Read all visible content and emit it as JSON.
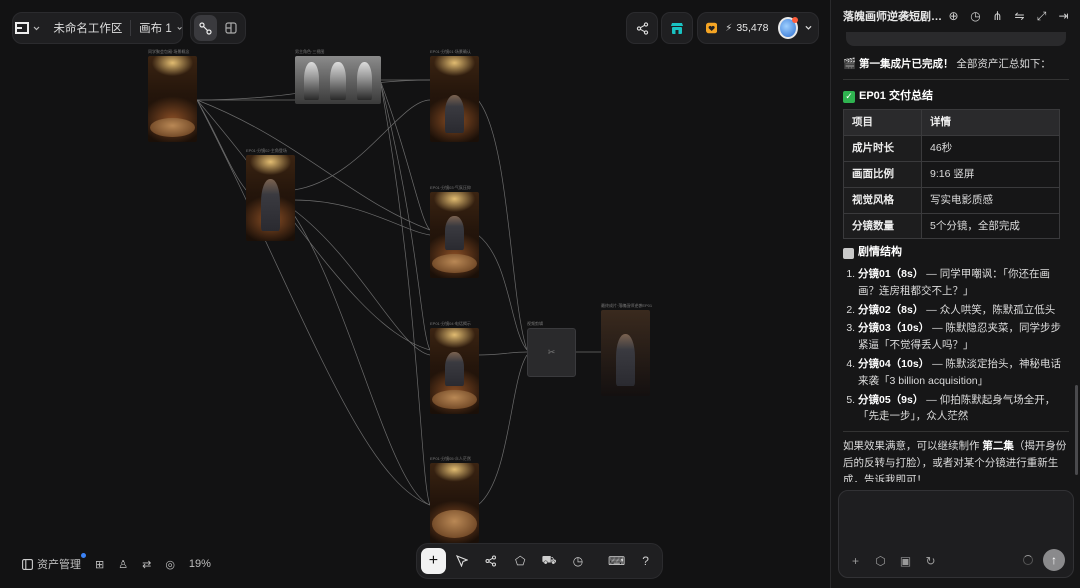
{
  "header": {
    "workspace_name": "未命名工作区",
    "canvas_name": "画布 1",
    "credits": "35,478"
  },
  "bottom_bar": {
    "assets_label": "资产管理",
    "zoom": "19%"
  },
  "canvas": {
    "node_labels": [
      "同学聚会包厢·场景概念",
      "男主角色·三视图",
      "EP01·分镜01·场景确认",
      "EP01·分镜02·主角登场",
      "EP01·分镜03·气氛压抑",
      "EP01·分镜04·电话揭示",
      "EP01·分镜05·众人茫然",
      "视频剪辑",
      "最终成片·落魄画师逆袭EP01"
    ]
  },
  "panel": {
    "title": "落魄画师逆袭短剧…",
    "intro_emoji": "🎬",
    "intro_bold": "第一集成片已完成！",
    "intro_rest": "全部资产汇总如下：",
    "delivery_heading": "EP01 交付总结",
    "table": {
      "headers": [
        "项目",
        "详情"
      ],
      "rows": [
        {
          "k": "成片时长",
          "v": "46秒"
        },
        {
          "k": "画面比例",
          "v": "9:16 竖屏"
        },
        {
          "k": "视觉风格",
          "v": "写实电影质感"
        },
        {
          "k": "分镜数量",
          "v": "5个分镜，全部完成"
        }
      ]
    },
    "plot_heading": "剧情结构",
    "shots": [
      {
        "title": "分镜01（8s）",
        "desc": " — 同学甲嘲讽：「你还在画画？连房租都交不上？」"
      },
      {
        "title": "分镜02（8s）",
        "desc": " — 众人哄笑，陈默孤立低头"
      },
      {
        "title": "分镜03（10s）",
        "desc": " — 陈默隐忍夹菜，同学步步紧逼「不觉得丢人吗？」"
      },
      {
        "title": "分镜04（10s）",
        "desc": " — 陈默淡定抬头，神秘电话来袭「3 billion acquisition」"
      },
      {
        "title": "分镜05（9s）",
        "desc": " — 仰拍陈默起身气场全开，「先走一步」，众人茫然"
      }
    ],
    "outro_pre": "如果效果满意，可以继续制作 ",
    "outro_bold": "第二集",
    "outro_post": "（揭开身份后的反转与打脸），或者对某个分镜进行重新生成，告诉我即可！",
    "input_placeholder": ""
  },
  "colors": {
    "accent_orange": "#f5a524",
    "check_green": "#2fb350",
    "send_button": "#8a8a8c",
    "blue_dot": "#3b82f6"
  }
}
